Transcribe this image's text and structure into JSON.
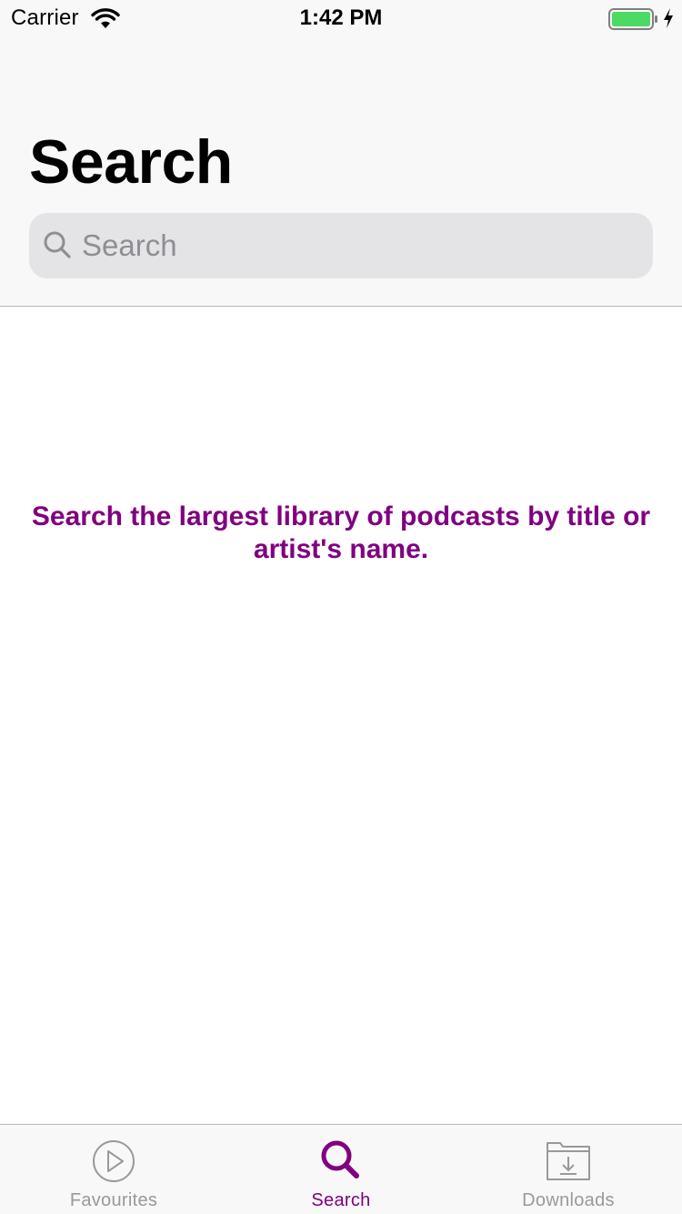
{
  "status_bar": {
    "carrier": "Carrier",
    "time": "1:42 PM"
  },
  "header": {
    "title": "Search"
  },
  "search": {
    "placeholder": "Search",
    "value": "",
    "icon": "magnifier-icon"
  },
  "empty_state": {
    "message": "Search the largest library of podcasts by title or artist's name."
  },
  "tab_bar": {
    "tabs": [
      {
        "label": "Favourites",
        "icon": "play-circle-icon",
        "selected": false
      },
      {
        "label": "Search",
        "icon": "search-icon",
        "selected": true
      },
      {
        "label": "Downloads",
        "icon": "downloads-folder-icon",
        "selected": false
      }
    ]
  },
  "colors": {
    "accent": "#800080",
    "inactive_tab": "#999999",
    "battery_fill": "#4cd964",
    "search_field_bg": "#e4e4e7",
    "placeholder": "#8e8e93"
  }
}
